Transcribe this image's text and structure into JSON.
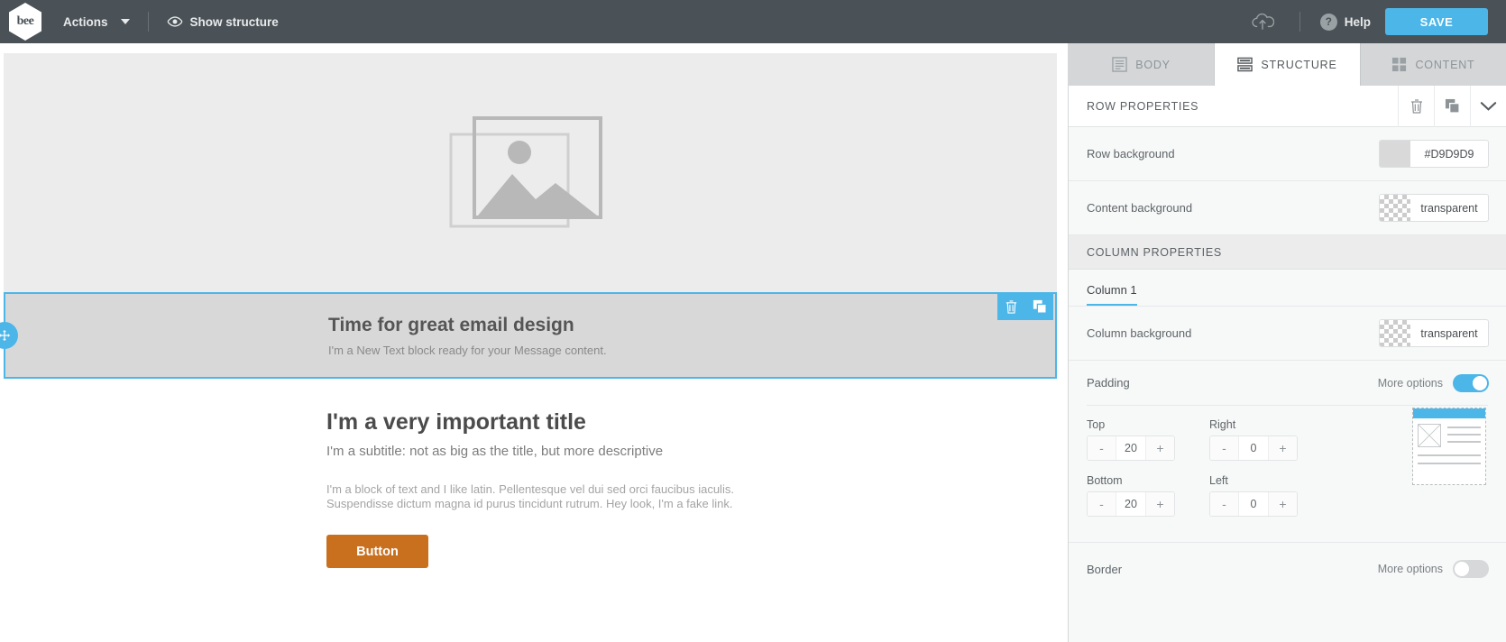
{
  "topbar": {
    "logo_text": "bee",
    "actions_label": "Actions",
    "show_structure_label": "Show structure",
    "help_label": "Help",
    "help_glyph": "?",
    "save_label": "SAVE",
    "accent_color": "#4cb6e8",
    "background_color": "#4a5257"
  },
  "canvas": {
    "image_row": {
      "placeholder": "image-placeholder"
    },
    "selected_row": {
      "title": "Time for great email design",
      "subtitle": "I'm a New Text block ready for your Message content.",
      "background_color": "#D9D9D9",
      "selection_color": "#4cb6e8"
    },
    "content_row": {
      "title": "I'm a very important title",
      "subtitle": "I'm a subtitle: not as big as the title, but more descriptive",
      "paragraph": "I'm a block of text and I like latin. Pellentesque vel dui sed orci faucibus iaculis. Suspendisse dictum magna id purus tincidunt rutrum. Hey look, I'm a fake link.",
      "button_label": "Button",
      "button_color": "#C9701F"
    }
  },
  "panel": {
    "tabs": [
      {
        "label": "BODY",
        "icon": "body-icon",
        "active": false
      },
      {
        "label": "STRUCTURE",
        "icon": "structure-icon",
        "active": true
      },
      {
        "label": "CONTENT",
        "icon": "content-icon",
        "active": false
      }
    ],
    "row_properties": {
      "title": "ROW PROPERTIES",
      "actions": [
        "delete-icon",
        "duplicate-icon",
        "collapse-icon"
      ],
      "fields": [
        {
          "label": "Row background",
          "value": "#D9D9D9",
          "swatch": "solid"
        },
        {
          "label": "Content background",
          "value": "transparent",
          "swatch": "checker"
        }
      ]
    },
    "column_properties": {
      "title": "COLUMN PROPERTIES",
      "column_tab": "Column 1",
      "fields": [
        {
          "label": "Column background",
          "value": "transparent",
          "swatch": "checker"
        }
      ],
      "padding": {
        "label": "Padding",
        "more_options_label": "More options",
        "enabled": true,
        "values": [
          {
            "label": "Top",
            "value": "20",
            "minus": "-",
            "plus": "+"
          },
          {
            "label": "Right",
            "value": "0",
            "minus": "-",
            "plus": "+"
          },
          {
            "label": "Bottom",
            "value": "20",
            "minus": "-",
            "plus": "+"
          },
          {
            "label": "Left",
            "value": "0",
            "minus": "-",
            "plus": "+"
          }
        ]
      },
      "border": {
        "label": "Border",
        "more_options_label": "More options",
        "enabled": false
      }
    }
  }
}
